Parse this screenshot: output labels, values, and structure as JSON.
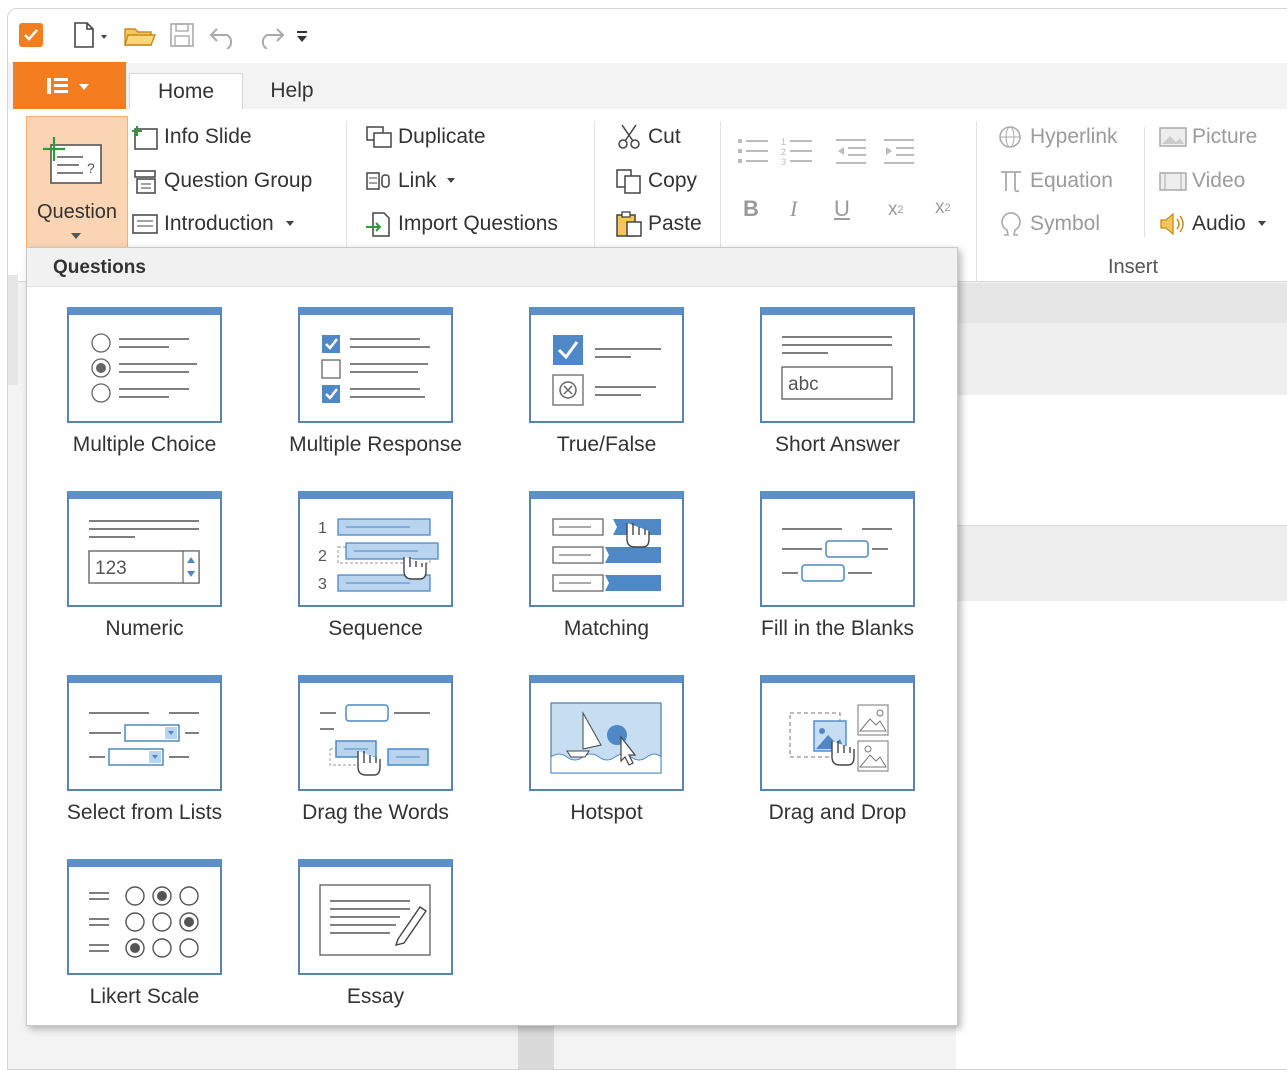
{
  "app": {
    "accent": "#f47d20",
    "quick_access": [
      "app-icon",
      "new-icon",
      "open-icon",
      "save-icon",
      "undo-icon",
      "redo-icon",
      "customize-icon"
    ]
  },
  "tabs": {
    "home": "Home",
    "help": "Help"
  },
  "ribbon": {
    "question": "Question",
    "info_slide": "Info Slide",
    "question_group": "Question Group",
    "introduction": "Introduction",
    "duplicate": "Duplicate",
    "link": "Link",
    "import_questions": "Import Questions",
    "cut": "Cut",
    "copy": "Copy",
    "paste": "Paste",
    "bold": "B",
    "italic": "I",
    "underline": "U",
    "subscript": "x",
    "subscript_sub": "2",
    "superscript": "x",
    "superscript_sup": "2",
    "hyperlink": "Hyperlink",
    "equation": "Equation",
    "symbol": "Symbol",
    "picture": "Picture",
    "video": "Video",
    "audio": "Audio",
    "insert_group": "Insert"
  },
  "questions_menu": {
    "title": "Questions",
    "items": [
      {
        "label": "Multiple Choice",
        "icon": "multiple-choice-icon"
      },
      {
        "label": "Multiple Response",
        "icon": "multiple-response-icon"
      },
      {
        "label": "True/False",
        "icon": "true-false-icon"
      },
      {
        "label": "Short Answer",
        "icon": "short-answer-icon"
      },
      {
        "label": "Numeric",
        "icon": "numeric-icon"
      },
      {
        "label": "Sequence",
        "icon": "sequence-icon"
      },
      {
        "label": "Matching",
        "icon": "matching-icon"
      },
      {
        "label": "Fill in the Blanks",
        "icon": "fill-in-the-blanks-icon"
      },
      {
        "label": "Select from Lists",
        "icon": "select-from-lists-icon"
      },
      {
        "label": "Drag the Words",
        "icon": "drag-the-words-icon"
      },
      {
        "label": "Hotspot",
        "icon": "hotspot-icon"
      },
      {
        "label": "Drag and Drop",
        "icon": "drag-and-drop-icon"
      },
      {
        "label": "Likert Scale",
        "icon": "likert-scale-icon"
      },
      {
        "label": "Essay",
        "icon": "essay-icon"
      }
    ],
    "short_answer_sample": "abc",
    "numeric_sample": "123",
    "sequence_numbers": [
      "1",
      "2",
      "3"
    ]
  }
}
